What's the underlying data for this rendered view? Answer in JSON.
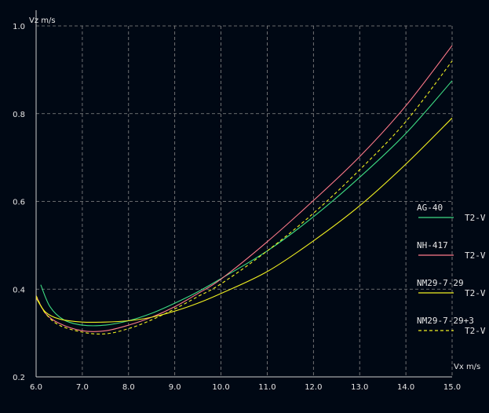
{
  "chart_data": {
    "type": "line",
    "xlabel": "Vx m/s",
    "ylabel": "Vz m/s",
    "xlim": [
      6.0,
      15.0
    ],
    "ylim": [
      0.2,
      1.0
    ],
    "x_ticks": [
      "6.0",
      "7.0",
      "8.0",
      "9.0",
      "10.0",
      "11.0",
      "12.0",
      "13.0",
      "14.0",
      "15.0"
    ],
    "y_ticks": [
      "0.2",
      "0.4",
      "0.6",
      "0.8",
      "1.0"
    ],
    "grid": true,
    "legend_position": "right",
    "colors": {
      "background": "#000814",
      "grid": "#8a8a8a",
      "axis": "#cccccc",
      "text": "#e6e6e6"
    },
    "series": [
      {
        "name": "AG-40",
        "sublabel": "T2-V",
        "color": "#3ddc84",
        "dash": "solid",
        "x": [
          6.1,
          6.3,
          6.6,
          7.0,
          7.5,
          8.0,
          8.5,
          9.0,
          9.5,
          10.0,
          11.0,
          12.0,
          13.0,
          14.0,
          15.0
        ],
        "y": [
          0.41,
          0.36,
          0.33,
          0.318,
          0.318,
          0.328,
          0.345,
          0.368,
          0.394,
          0.424,
          0.487,
          0.565,
          0.655,
          0.755,
          0.875
        ]
      },
      {
        "name": "NH-417",
        "sublabel": "T2-V",
        "color": "#ff7a8a",
        "dash": "solid",
        "x": [
          6.0,
          6.2,
          6.5,
          7.0,
          7.5,
          8.0,
          8.5,
          9.0,
          9.5,
          10.0,
          11.0,
          12.0,
          13.0,
          14.0,
          15.0
        ],
        "y": [
          0.385,
          0.345,
          0.322,
          0.305,
          0.305,
          0.318,
          0.336,
          0.36,
          0.39,
          0.423,
          0.508,
          0.602,
          0.702,
          0.818,
          0.955
        ]
      },
      {
        "name": "NM29-7-29",
        "sublabel": "T2-V",
        "color": "#f0f020",
        "dash": "solid",
        "x": [
          6.0,
          6.2,
          6.5,
          7.0,
          7.5,
          8.0,
          8.5,
          9.0,
          9.5,
          10.0,
          11.0,
          12.0,
          13.0,
          14.0,
          15.0
        ],
        "y": [
          0.38,
          0.348,
          0.332,
          0.325,
          0.325,
          0.328,
          0.336,
          0.35,
          0.368,
          0.39,
          0.44,
          0.51,
          0.59,
          0.685,
          0.79
        ]
      },
      {
        "name": "NM29-7-29+3",
        "sublabel": "T2-V",
        "color": "#f0f020",
        "dash": "dashed",
        "x": [
          6.0,
          6.2,
          6.5,
          7.0,
          7.5,
          8.0,
          8.5,
          9.0,
          9.5,
          10.0,
          11.0,
          12.0,
          13.0,
          14.0,
          15.0
        ],
        "y": [
          0.385,
          0.345,
          0.318,
          0.302,
          0.298,
          0.31,
          0.33,
          0.355,
          0.383,
          0.412,
          0.487,
          0.573,
          0.672,
          0.782,
          0.92
        ]
      }
    ]
  }
}
